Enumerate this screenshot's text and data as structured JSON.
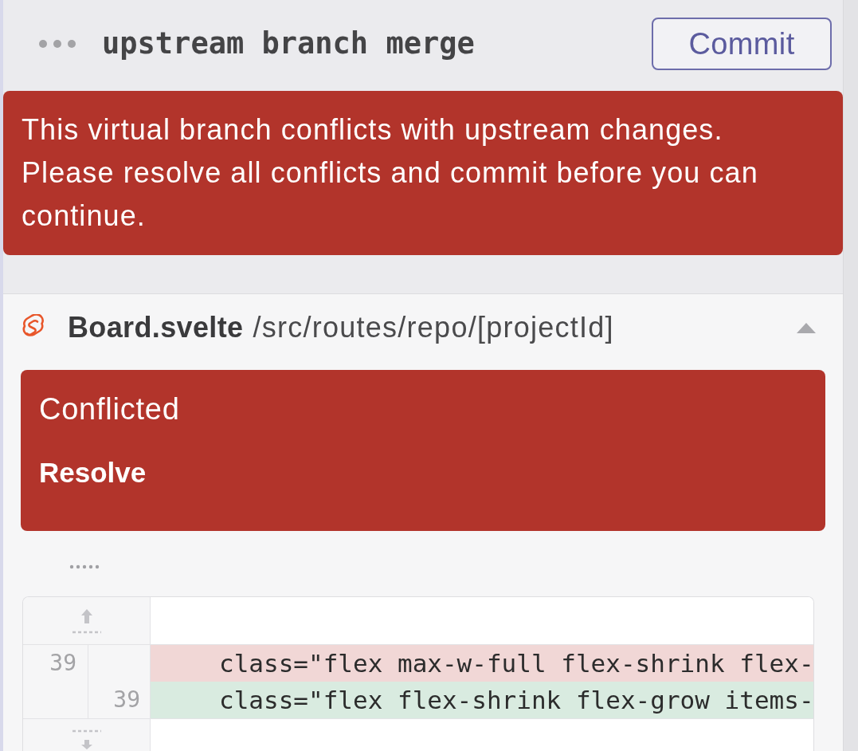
{
  "header": {
    "title": "upstream branch merge",
    "commit_button": "Commit"
  },
  "alert": {
    "message": "This virtual branch conflicts with upstream changes. Please resolve all conflicts and commit before you can continue."
  },
  "file": {
    "name": "Board.svelte",
    "path": "/src/routes/repo/[projectId]",
    "expanded": true,
    "conflict": {
      "status": "Conflicted",
      "action": "Resolve"
    },
    "diff": {
      "lines": [
        {
          "kind": "expand_up"
        },
        {
          "kind": "removed",
          "old_number": "39",
          "code": "class=\"flex max-w-full flex-shrink flex-"
        },
        {
          "kind": "added",
          "new_number": "39",
          "code": "class=\"flex flex-shrink flex-grow items-"
        },
        {
          "kind": "expand_down"
        }
      ]
    }
  }
}
